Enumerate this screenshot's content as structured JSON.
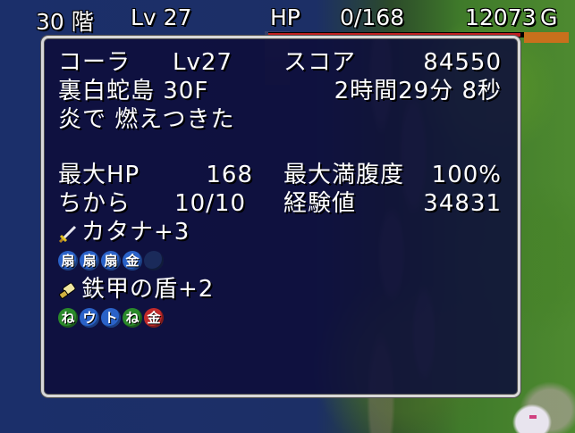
{
  "hud": {
    "floor": "30 階",
    "level": "Lv 27",
    "hp_label": "HP",
    "hp": "0/168",
    "hp_fraction": 0,
    "gold": "12073",
    "gold_unit": "G"
  },
  "result": {
    "name": "コーラ",
    "level": "Lv27",
    "score_label": "スコア",
    "score": "84550",
    "dungeon": "裏白蛇島 30F",
    "time": "2時間29分 8秒",
    "cause": "炎で 燃えつきた",
    "max_hp_label": "最大HP",
    "max_hp": "168",
    "max_fullness_label": "最大満腹度",
    "max_fullness": "100%",
    "strength_label": "ちから",
    "strength": "10/10",
    "exp_label": "経験値",
    "exp": "34831"
  },
  "weapon": {
    "name": "カタナ+3",
    "icon": "sword-icon",
    "seals": [
      {
        "label": "扇",
        "color": "#2a62c8"
      },
      {
        "label": "扇",
        "color": "#2a62c8"
      },
      {
        "label": "扇",
        "color": "#2a62c8"
      },
      {
        "label": "金",
        "color": "#2a62c8"
      },
      {
        "label": "",
        "color": "#1a2a5a"
      }
    ]
  },
  "shield": {
    "name": "鉄甲の盾+2",
    "icon": "shield-icon",
    "seals": [
      {
        "label": "ね",
        "color": "#2a8a2a"
      },
      {
        "label": "ウ",
        "color": "#2a62c8"
      },
      {
        "label": "ト",
        "color": "#2a62c8"
      },
      {
        "label": "ね",
        "color": "#2a8a2a"
      },
      {
        "label": "金",
        "color": "#c02a2a"
      }
    ]
  }
}
